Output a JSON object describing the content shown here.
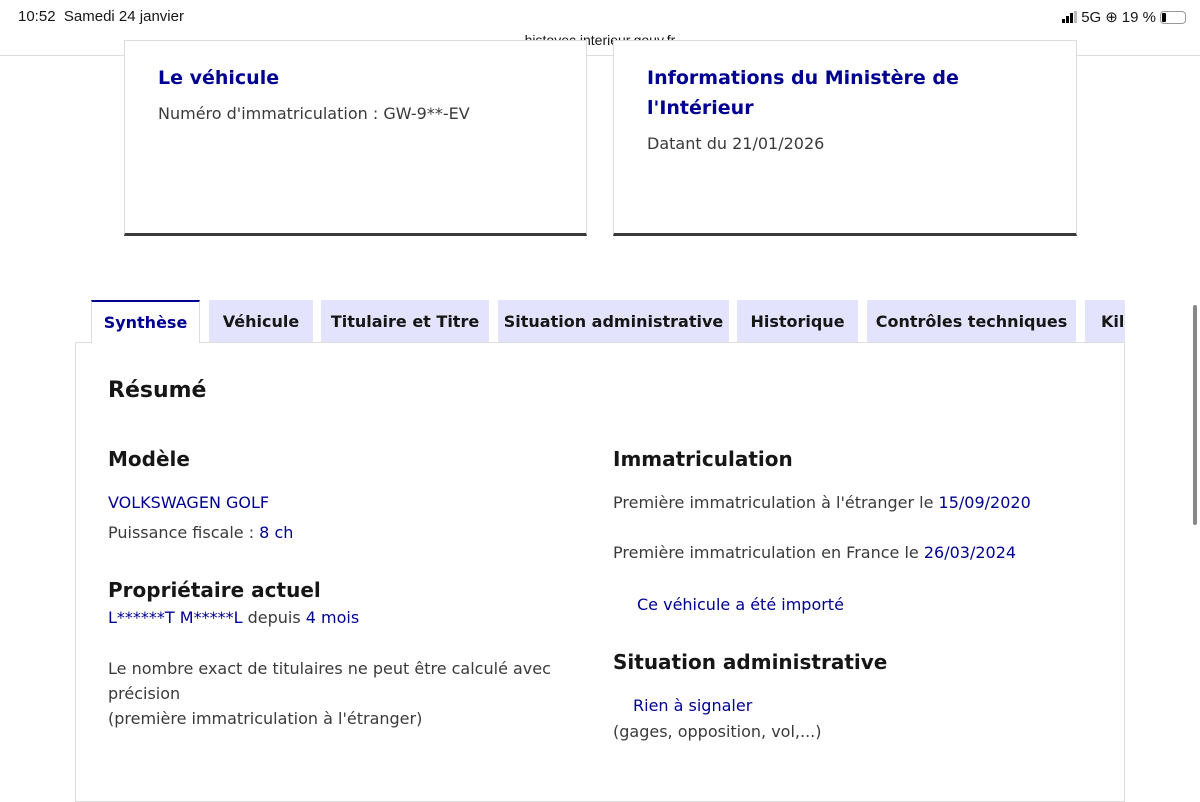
{
  "status": {
    "time": "10:52",
    "date": "Samedi 24 janvier",
    "network": "5G",
    "battery": "19 %",
    "url": "histovec.interieur.gouv.fr"
  },
  "cards": {
    "vehicle": {
      "title": "Le véhicule",
      "plate_label": "Numéro d'immatriculation : ",
      "plate": "GW-9**-EV"
    },
    "ministry": {
      "title_line1": "Informations du Ministère de",
      "title_line2": "l'Intérieur",
      "date": "Datant du 21/01/2026"
    }
  },
  "tabs": [
    "Synthèse",
    "Véhicule",
    "Titulaire et Titre",
    "Situation administrative",
    "Historique",
    "Contrôles techniques",
    "Kilométrage"
  ],
  "summary": {
    "title": "Résumé",
    "model": {
      "heading": "Modèle",
      "name": "VOLKSWAGEN GOLF",
      "power_label": "Puissance fiscale : ",
      "power": "8 ch"
    },
    "owner": {
      "heading": "Propriétaire actuel",
      "name": "L******T M*****L",
      "since_label": " depuis ",
      "since": "4 mois"
    },
    "owners_note": {
      "line1": "Le nombre exact de titulaires ne peut être calculé avec",
      "line2": "précision",
      "line3": "(première immatriculation à l'étranger)"
    },
    "registration": {
      "heading": "Immatriculation",
      "foreign_label": "Première immatriculation à l'étranger le ",
      "foreign_date": "15/09/2020",
      "france_label": "Première immatriculation en France le ",
      "france_date": "26/03/2024",
      "imported": "Ce véhicule a été importé"
    },
    "admin": {
      "heading": "Situation administrative",
      "status": "Rien à signaler",
      "note": "(gages, opposition, vol,...)"
    }
  },
  "colors": {
    "accent": "#000091",
    "tab_bg": "#e3e3fd"
  }
}
